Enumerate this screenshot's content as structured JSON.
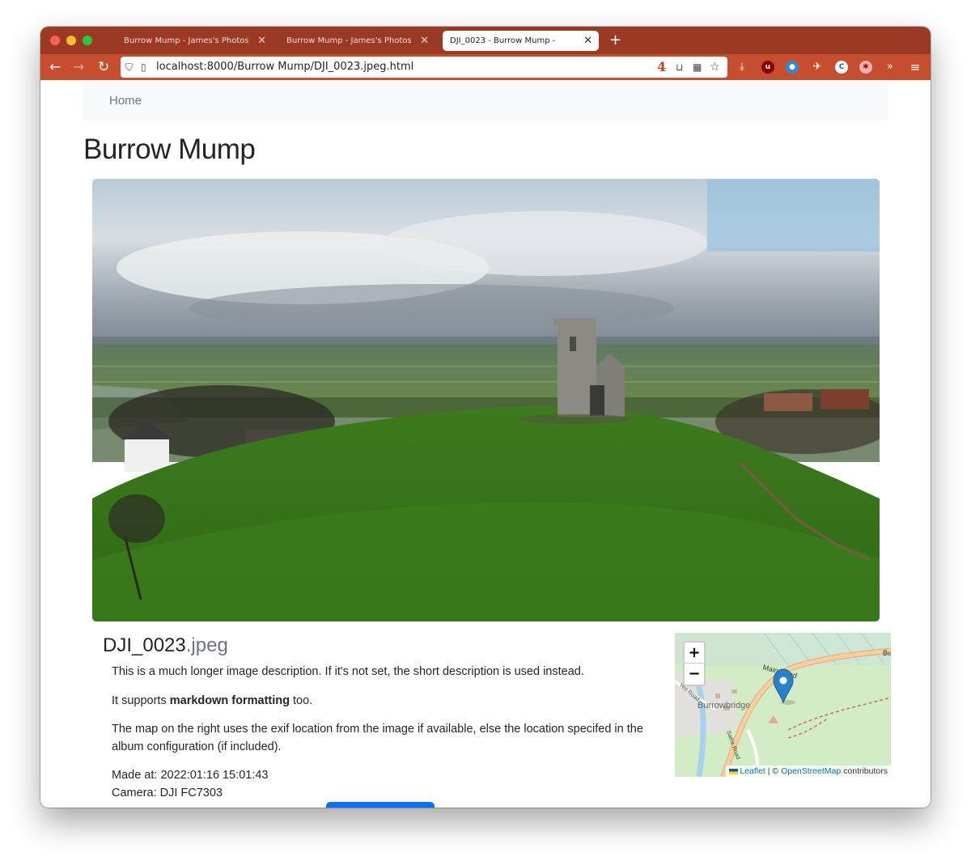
{
  "browser": {
    "tabs": [
      {
        "title": "Burrow Mump - James's Photos",
        "active": false
      },
      {
        "title": "Burrow Mump - James's Photos",
        "active": false
      },
      {
        "title": "DJI_0023 - Burrow Mump -",
        "active": true
      }
    ],
    "new_tab_icon": "plus-icon",
    "url": "localhost:8000/Burrow Mump/DJI_0023.jpeg.html",
    "extension_badge": "4",
    "accent_color": "#c64d2d"
  },
  "breadcrumb": {
    "home_label": "Home"
  },
  "page": {
    "title": "Burrow Mump",
    "photo_alt": "Aerial view of Burrow Mump church ruin on a green hill",
    "file_name": "DJI_0023",
    "file_ext": ".jpeg",
    "description_p1": "This is a much longer image description. If it's not set, the short description is used instead.",
    "description_p2_pre": "It supports ",
    "description_p2_bold": "markdown formatting",
    "description_p2_post": " too.",
    "description_p3": "The map on the right uses the exif location from the image if available, else the location specifed in the album configuration (if included).",
    "made_at": "Made at: 2022:01:16 15:01:43",
    "camera": "Camera: DJI FC7303"
  },
  "map": {
    "zoom_in": "+",
    "zoom_out": "−",
    "label_main_road": "Main Road",
    "label_town": "Burrowbridge",
    "label_bu": "Bu",
    "label_yeo_road": "Yeo Road",
    "label_sathe_road": "Sathe Road",
    "attribution_leaflet": "Leaflet",
    "attribution_sep": " | © ",
    "attribution_osm": "OpenStreetMap",
    "attribution_tail": " contributors"
  }
}
